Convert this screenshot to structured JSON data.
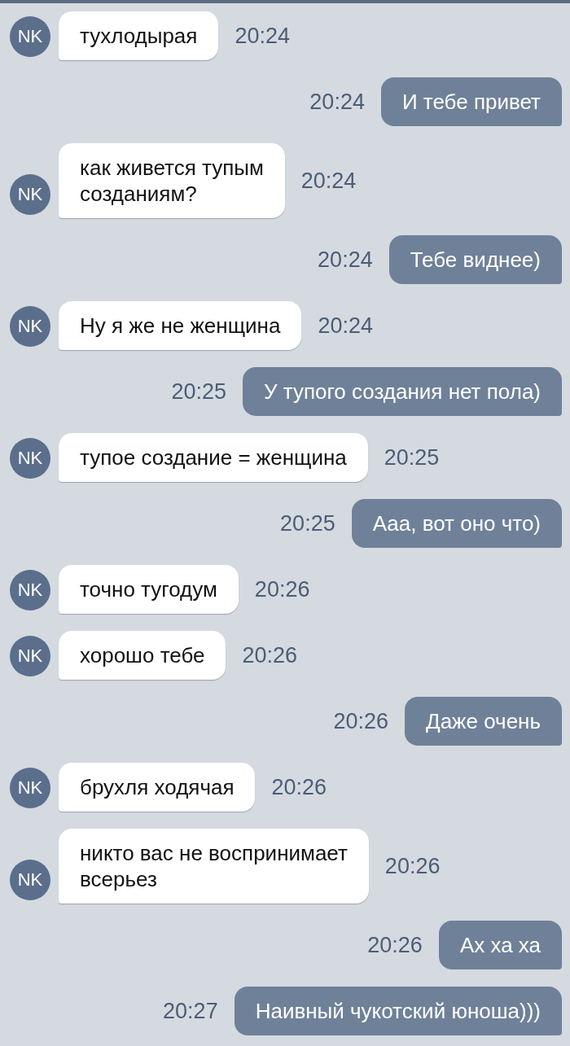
{
  "messages": [
    {
      "kind": "incoming",
      "avatar": "NK",
      "text": "тухлодырая",
      "time": "20:24"
    },
    {
      "kind": "outgoing",
      "text": "И тебе привет",
      "time": "20:24"
    },
    {
      "kind": "incoming",
      "avatar": "NK",
      "text": "как живется тупым\nсозданиям?",
      "time": "20:24"
    },
    {
      "kind": "outgoing",
      "text": "Тебе виднее)",
      "time": "20:24"
    },
    {
      "kind": "incoming",
      "avatar": "NK",
      "text": "Ну я же не женщина",
      "time": "20:24"
    },
    {
      "kind": "outgoing",
      "text": "У тупого создания нет пола)",
      "time": "20:25"
    },
    {
      "kind": "incoming",
      "avatar": "NK",
      "text": "тупое создание = женщина",
      "time": "20:25"
    },
    {
      "kind": "outgoing",
      "text": "Ааа, вот оно что)",
      "time": "20:25"
    },
    {
      "kind": "incoming",
      "avatar": "NK",
      "text": "точно тугодум",
      "time": "20:26"
    },
    {
      "kind": "incoming",
      "avatar": "NK",
      "text": "хорошо тебе",
      "time": "20:26"
    },
    {
      "kind": "outgoing",
      "text": "Даже очень",
      "time": "20:26"
    },
    {
      "kind": "incoming",
      "avatar": "NK",
      "text": "брухля ходячая",
      "time": "20:26"
    },
    {
      "kind": "incoming",
      "avatar": "NK",
      "text": "никто вас не воспринимает\nвсерьез",
      "time": "20:26"
    },
    {
      "kind": "outgoing",
      "text": "Ах ха ха",
      "time": "20:26"
    },
    {
      "kind": "outgoing",
      "text": "Наивный чукотский юноша)))",
      "time": "20:27"
    }
  ]
}
